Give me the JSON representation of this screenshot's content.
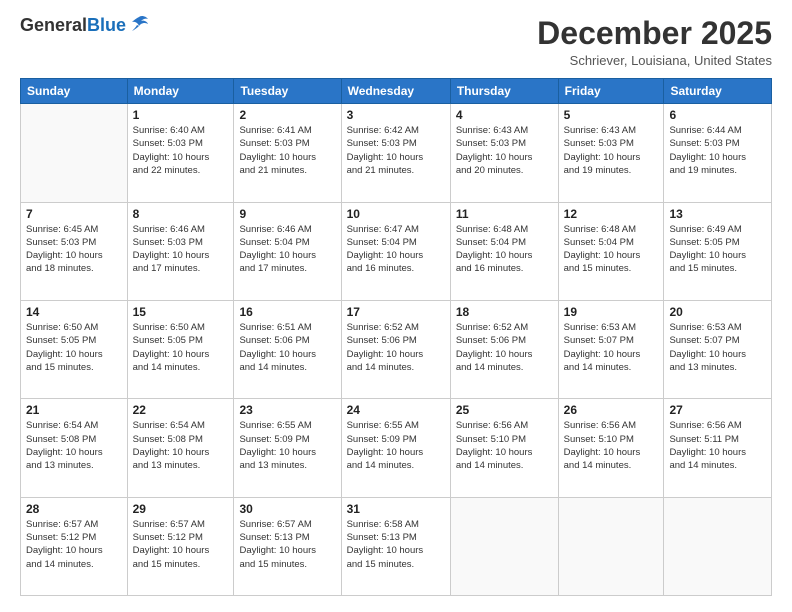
{
  "logo": {
    "general": "General",
    "blue": "Blue"
  },
  "title": "December 2025",
  "location": "Schriever, Louisiana, United States",
  "days_header": [
    "Sunday",
    "Monday",
    "Tuesday",
    "Wednesday",
    "Thursday",
    "Friday",
    "Saturday"
  ],
  "weeks": [
    [
      {
        "num": "",
        "info": ""
      },
      {
        "num": "1",
        "info": "Sunrise: 6:40 AM\nSunset: 5:03 PM\nDaylight: 10 hours\nand 22 minutes."
      },
      {
        "num": "2",
        "info": "Sunrise: 6:41 AM\nSunset: 5:03 PM\nDaylight: 10 hours\nand 21 minutes."
      },
      {
        "num": "3",
        "info": "Sunrise: 6:42 AM\nSunset: 5:03 PM\nDaylight: 10 hours\nand 21 minutes."
      },
      {
        "num": "4",
        "info": "Sunrise: 6:43 AM\nSunset: 5:03 PM\nDaylight: 10 hours\nand 20 minutes."
      },
      {
        "num": "5",
        "info": "Sunrise: 6:43 AM\nSunset: 5:03 PM\nDaylight: 10 hours\nand 19 minutes."
      },
      {
        "num": "6",
        "info": "Sunrise: 6:44 AM\nSunset: 5:03 PM\nDaylight: 10 hours\nand 19 minutes."
      }
    ],
    [
      {
        "num": "7",
        "info": "Sunrise: 6:45 AM\nSunset: 5:03 PM\nDaylight: 10 hours\nand 18 minutes."
      },
      {
        "num": "8",
        "info": "Sunrise: 6:46 AM\nSunset: 5:03 PM\nDaylight: 10 hours\nand 17 minutes."
      },
      {
        "num": "9",
        "info": "Sunrise: 6:46 AM\nSunset: 5:04 PM\nDaylight: 10 hours\nand 17 minutes."
      },
      {
        "num": "10",
        "info": "Sunrise: 6:47 AM\nSunset: 5:04 PM\nDaylight: 10 hours\nand 16 minutes."
      },
      {
        "num": "11",
        "info": "Sunrise: 6:48 AM\nSunset: 5:04 PM\nDaylight: 10 hours\nand 16 minutes."
      },
      {
        "num": "12",
        "info": "Sunrise: 6:48 AM\nSunset: 5:04 PM\nDaylight: 10 hours\nand 15 minutes."
      },
      {
        "num": "13",
        "info": "Sunrise: 6:49 AM\nSunset: 5:05 PM\nDaylight: 10 hours\nand 15 minutes."
      }
    ],
    [
      {
        "num": "14",
        "info": "Sunrise: 6:50 AM\nSunset: 5:05 PM\nDaylight: 10 hours\nand 15 minutes."
      },
      {
        "num": "15",
        "info": "Sunrise: 6:50 AM\nSunset: 5:05 PM\nDaylight: 10 hours\nand 14 minutes."
      },
      {
        "num": "16",
        "info": "Sunrise: 6:51 AM\nSunset: 5:06 PM\nDaylight: 10 hours\nand 14 minutes."
      },
      {
        "num": "17",
        "info": "Sunrise: 6:52 AM\nSunset: 5:06 PM\nDaylight: 10 hours\nand 14 minutes."
      },
      {
        "num": "18",
        "info": "Sunrise: 6:52 AM\nSunset: 5:06 PM\nDaylight: 10 hours\nand 14 minutes."
      },
      {
        "num": "19",
        "info": "Sunrise: 6:53 AM\nSunset: 5:07 PM\nDaylight: 10 hours\nand 14 minutes."
      },
      {
        "num": "20",
        "info": "Sunrise: 6:53 AM\nSunset: 5:07 PM\nDaylight: 10 hours\nand 13 minutes."
      }
    ],
    [
      {
        "num": "21",
        "info": "Sunrise: 6:54 AM\nSunset: 5:08 PM\nDaylight: 10 hours\nand 13 minutes."
      },
      {
        "num": "22",
        "info": "Sunrise: 6:54 AM\nSunset: 5:08 PM\nDaylight: 10 hours\nand 13 minutes."
      },
      {
        "num": "23",
        "info": "Sunrise: 6:55 AM\nSunset: 5:09 PM\nDaylight: 10 hours\nand 13 minutes."
      },
      {
        "num": "24",
        "info": "Sunrise: 6:55 AM\nSunset: 5:09 PM\nDaylight: 10 hours\nand 14 minutes."
      },
      {
        "num": "25",
        "info": "Sunrise: 6:56 AM\nSunset: 5:10 PM\nDaylight: 10 hours\nand 14 minutes."
      },
      {
        "num": "26",
        "info": "Sunrise: 6:56 AM\nSunset: 5:10 PM\nDaylight: 10 hours\nand 14 minutes."
      },
      {
        "num": "27",
        "info": "Sunrise: 6:56 AM\nSunset: 5:11 PM\nDaylight: 10 hours\nand 14 minutes."
      }
    ],
    [
      {
        "num": "28",
        "info": "Sunrise: 6:57 AM\nSunset: 5:12 PM\nDaylight: 10 hours\nand 14 minutes."
      },
      {
        "num": "29",
        "info": "Sunrise: 6:57 AM\nSunset: 5:12 PM\nDaylight: 10 hours\nand 15 minutes."
      },
      {
        "num": "30",
        "info": "Sunrise: 6:57 AM\nSunset: 5:13 PM\nDaylight: 10 hours\nand 15 minutes."
      },
      {
        "num": "31",
        "info": "Sunrise: 6:58 AM\nSunset: 5:13 PM\nDaylight: 10 hours\nand 15 minutes."
      },
      {
        "num": "",
        "info": ""
      },
      {
        "num": "",
        "info": ""
      },
      {
        "num": "",
        "info": ""
      }
    ]
  ]
}
